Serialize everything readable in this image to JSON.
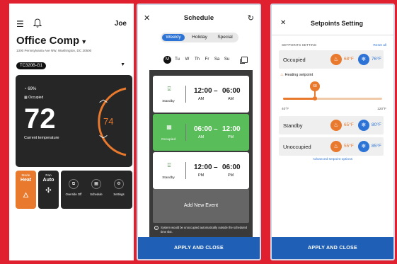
{
  "home": {
    "user": "Joe",
    "location": "Office Comp",
    "address": "1300 Pennsylvania Ave NW, Washington, DC 20500",
    "device": "TC320B-G1",
    "humidity": "69%",
    "occupancy": "Occupied",
    "current_temp": "72",
    "current_label": "Current temperature",
    "setpoint": "74",
    "mode_title": "Mode",
    "mode_value": "Heat",
    "fan_title": "Fan",
    "fan_value": "Auto",
    "actions": [
      "Override Off",
      "Schedule",
      "Settings"
    ]
  },
  "schedule": {
    "title": "Schedule",
    "tabs": [
      "Weekly",
      "Holiday",
      "Special"
    ],
    "days": [
      "M",
      "Tu",
      "W",
      "Th",
      "Fr",
      "Sa",
      "Su"
    ],
    "events": [
      {
        "mode": "Standby",
        "start": "12:00",
        "start_ap": "AM",
        "end": "06:00",
        "end_ap": "AM"
      },
      {
        "mode": "Occupied",
        "start": "06:00",
        "start_ap": "AM",
        "end": "12:00",
        "end_ap": "PM"
      },
      {
        "mode": "Standby",
        "start": "12:00",
        "start_ap": "PM",
        "end": "06:00",
        "end_ap": "PM"
      }
    ],
    "add_event": "Add New Event",
    "note": "System would be unoccupied automatically outside the scheduled time slot.",
    "apply": "APPLY AND CLOSE"
  },
  "setpoints": {
    "title": "Setpoints Setting",
    "section": "SETPOINTS SETTING",
    "reset": "Reset all",
    "rows": [
      {
        "name": "Occupied",
        "heat": "68°F",
        "cool": "76°F"
      },
      {
        "name": "Standby",
        "heat": "65°F",
        "cool": "80°F"
      },
      {
        "name": "Unoccupied",
        "heat": "55°F",
        "cool": "85°F"
      }
    ],
    "heating_label": "Heating setpoint",
    "heating_value": "68",
    "slider_fraction": 0.34,
    "min": "40°F",
    "max": "120°F",
    "advanced": "Advanced setpoint options",
    "apply": "APPLY AND CLOSE"
  },
  "colors": {
    "accent_blue": "#1f5fb5",
    "heat_orange": "#e8792d",
    "occupied_green": "#59bd59"
  }
}
